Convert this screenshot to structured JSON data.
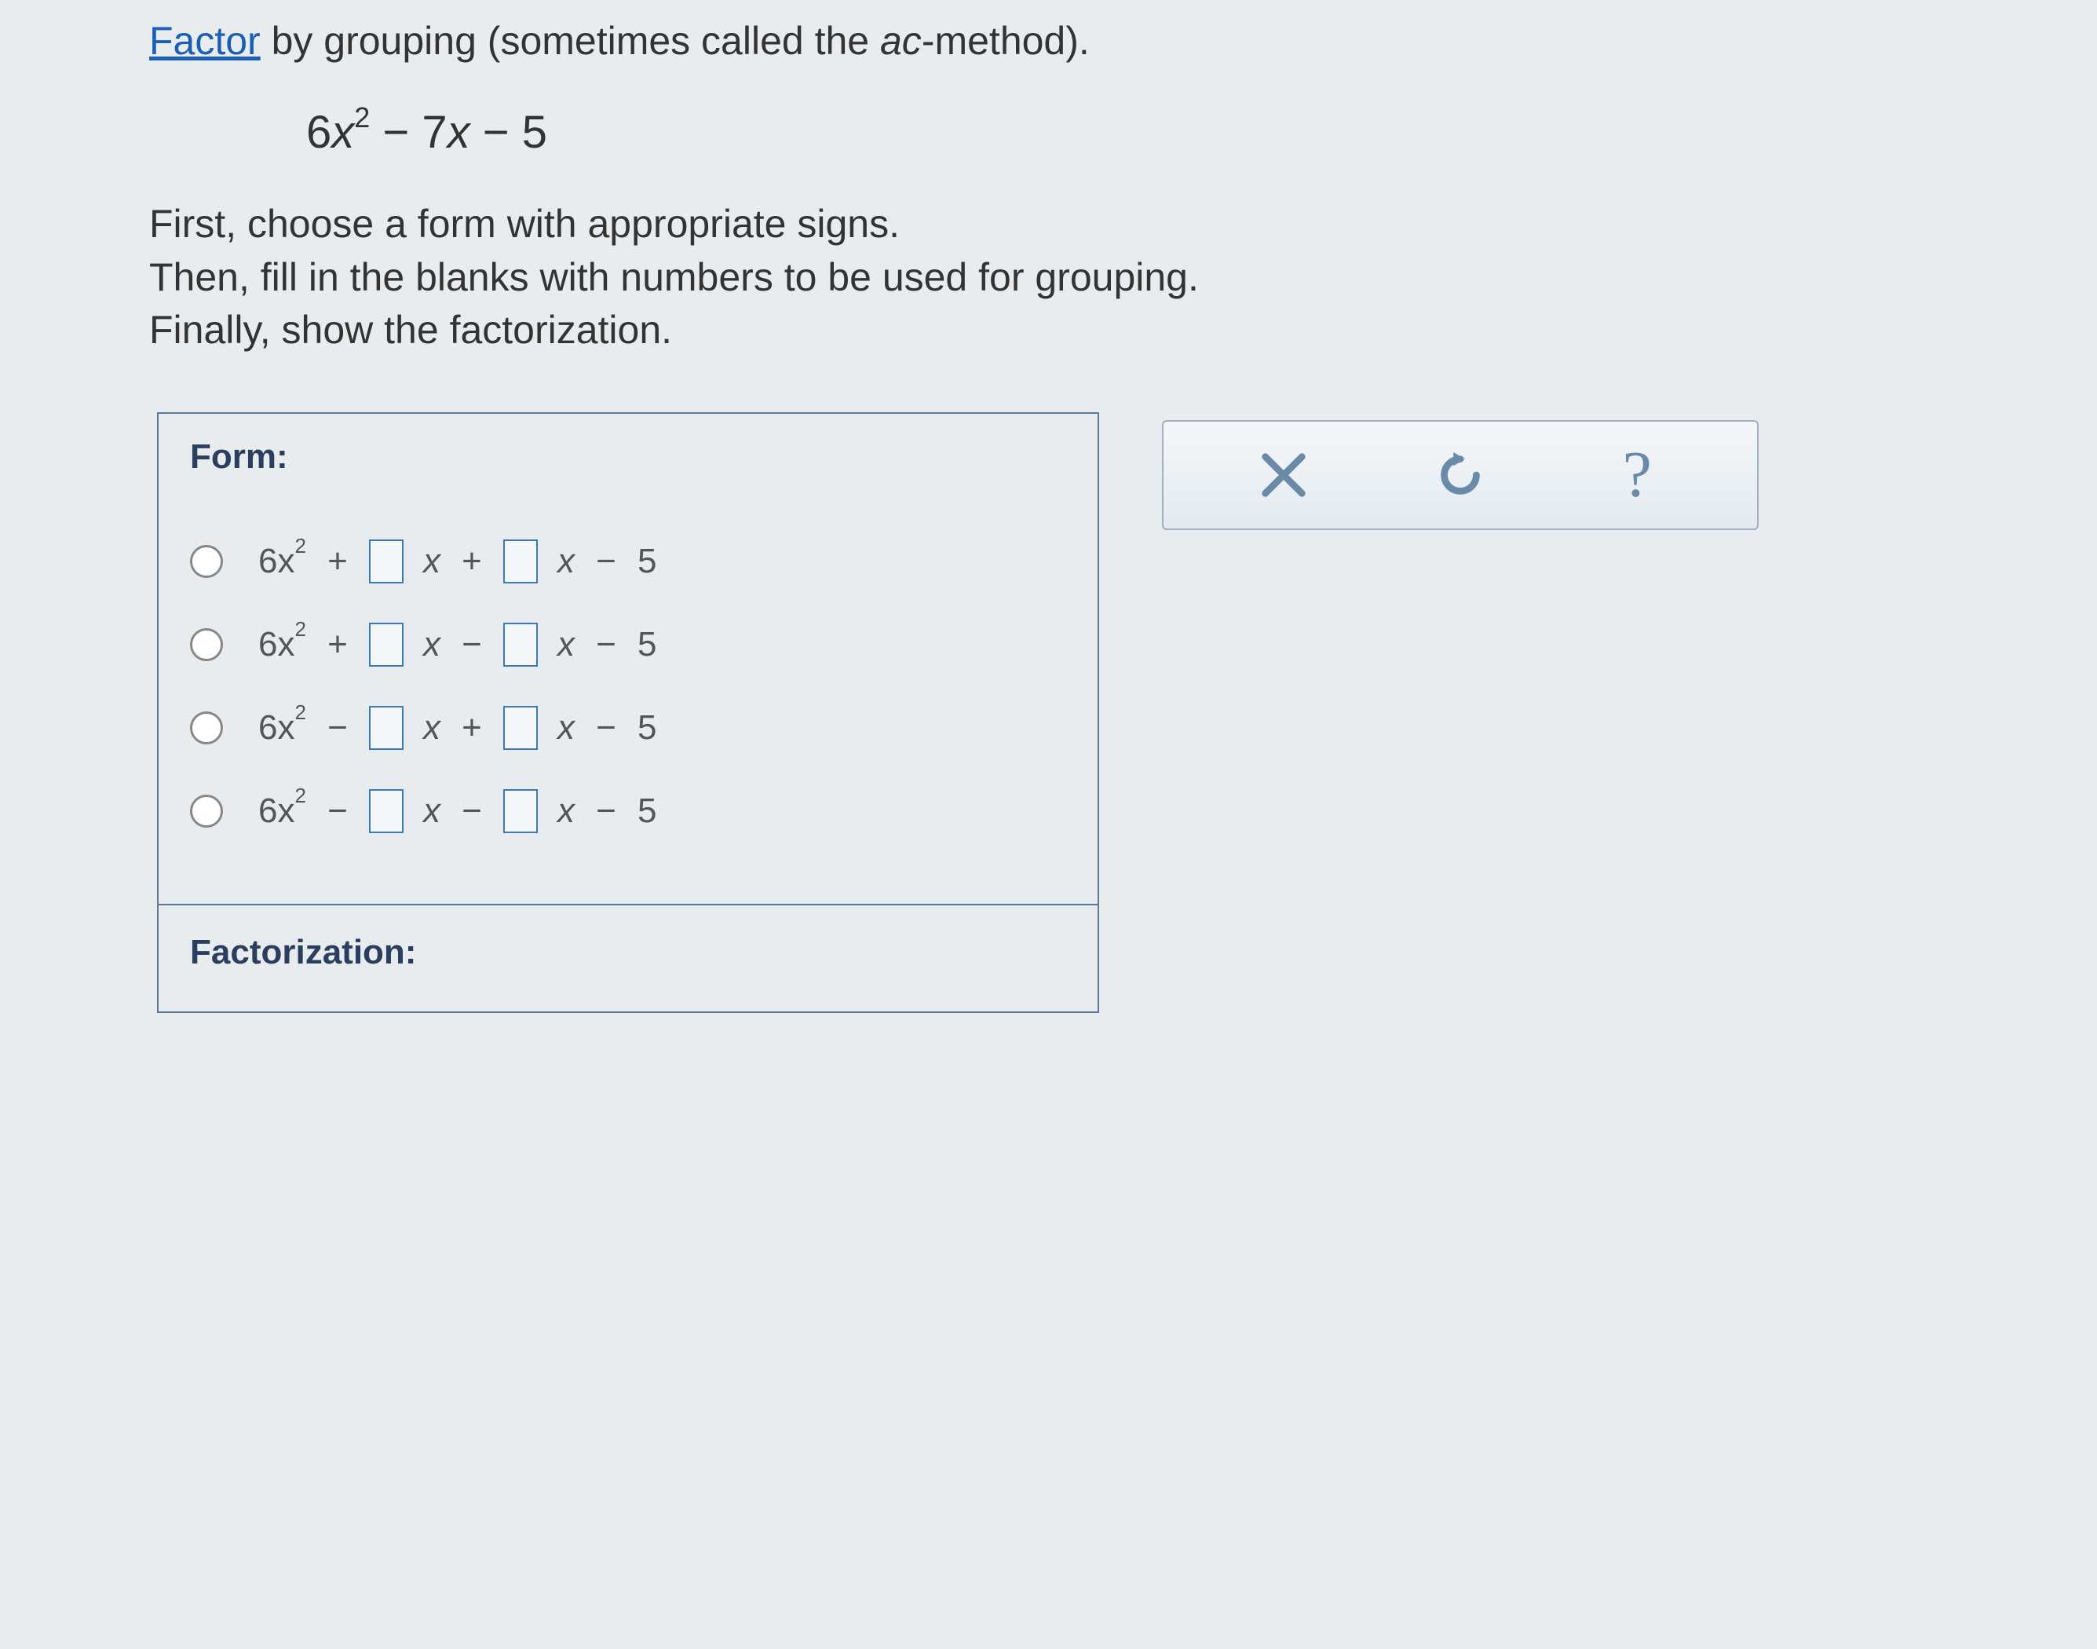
{
  "instruction": {
    "factor_word": "Factor",
    "rest": " by grouping (sometimes called the ",
    "ac": "ac",
    "method_end": "-method)."
  },
  "expression": {
    "text": "6x² − 7x − 5"
  },
  "body": {
    "line1": "First, choose a form with appropriate signs.",
    "line2": "Then, fill in the blanks with numbers to be used for grouping.",
    "line3": "Finally, show the factorization."
  },
  "form": {
    "title": "Form:",
    "options": [
      {
        "lead": "6x",
        "exp": "2",
        "s1": "+",
        "v1": "x",
        "s2": "+",
        "v2": "x",
        "s3": "−",
        "c": "5"
      },
      {
        "lead": "6x",
        "exp": "2",
        "s1": "+",
        "v1": "x",
        "s2": "−",
        "v2": "x",
        "s3": "−",
        "c": "5"
      },
      {
        "lead": "6x",
        "exp": "2",
        "s1": "−",
        "v1": "x",
        "s2": "+",
        "v2": "x",
        "s3": "−",
        "c": "5"
      },
      {
        "lead": "6x",
        "exp": "2",
        "s1": "−",
        "v1": "x",
        "s2": "−",
        "v2": "x",
        "s3": "−",
        "c": "5"
      }
    ],
    "factorization_title": "Factorization:"
  },
  "toolbox": {
    "clear": "clear",
    "reset": "reset",
    "help": "?"
  }
}
